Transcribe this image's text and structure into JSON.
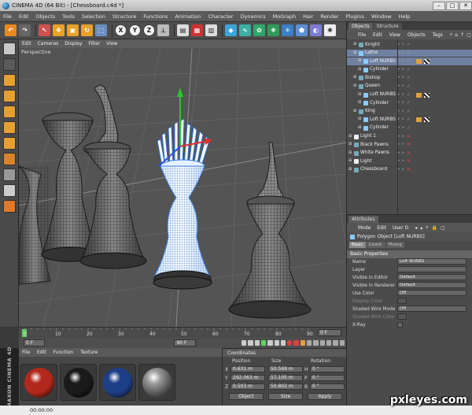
{
  "window": {
    "title": "CINEMA 4D (64 Bit) - [Chessboard.c4d *]"
  },
  "menu": [
    "File",
    "Edit",
    "Objects",
    "Tools",
    "Selection",
    "Structure",
    "Functions",
    "Animation",
    "Character",
    "Dynamics",
    "MoGraph",
    "Hair",
    "Render",
    "Plugins",
    "Window",
    "Help"
  ],
  "toolbar": {
    "axis_x": "X",
    "axis_y": "Y",
    "axis_z": "Z"
  },
  "viewport": {
    "menu": [
      "Edit",
      "Cameras",
      "Display",
      "Filter",
      "View"
    ],
    "label": "Perspective"
  },
  "timeline": {
    "ticks": [
      "0",
      "10",
      "20",
      "30",
      "40",
      "50",
      "60",
      "70",
      "80",
      "90"
    ],
    "end_label": "0 F",
    "start_frame": "0 F",
    "end_frame": "90 F"
  },
  "materials": {
    "menu": [
      "File",
      "Edit",
      "Function",
      "Texture"
    ],
    "swatches": [
      {
        "color": "#b3281d"
      },
      {
        "color": "#1a1a1a"
      },
      {
        "color": "#1e3f88"
      },
      {
        "color": "#8d8d8d"
      }
    ]
  },
  "maxon_logo": "MAXON CINEMA 4D",
  "coordinates": {
    "header": "Coordinates",
    "cols": [
      "Position",
      "Size",
      "Rotation"
    ],
    "rows": [
      {
        "axis": "X",
        "pos": "0.631 m",
        "size": "50.569 m",
        "rot_label": "H",
        "rot": "0 °"
      },
      {
        "axis": "Y",
        "pos": "292.063 m",
        "size": "57.105 m",
        "rot_label": "P",
        "rot": "0 °"
      },
      {
        "axis": "Z",
        "pos": "0.503 m",
        "size": "50.802 m",
        "rot_label": "B",
        "rot": "0 °"
      }
    ],
    "mode_object": "Object",
    "mode_size": "Size",
    "apply": "Apply"
  },
  "objects_panel": {
    "tabs": [
      "Objects",
      "Structure"
    ],
    "menu": [
      "File",
      "Edit",
      "View",
      "Objects",
      "Tags"
    ],
    "items": [
      {
        "label": "Knight",
        "indent": 1,
        "icon": "#7ab",
        "selected": false,
        "tag": false
      },
      {
        "label": "Lathe",
        "indent": 1,
        "icon": "#8cf",
        "selected": true,
        "tag": false
      },
      {
        "label": "Loft NURBS",
        "indent": 2,
        "icon": "#8cf",
        "selected": true,
        "tag": true
      },
      {
        "label": "Cylinder",
        "indent": 2,
        "icon": "#8cf",
        "selected": false,
        "tag": false
      },
      {
        "label": "Bishop",
        "indent": 1,
        "icon": "#7ab",
        "selected": false,
        "tag": false
      },
      {
        "label": "Queen",
        "indent": 1,
        "icon": "#7ab",
        "selected": false,
        "tag": false
      },
      {
        "label": "Loft NURBS",
        "indent": 2,
        "icon": "#8cf",
        "selected": false,
        "tag": true
      },
      {
        "label": "Cylinder",
        "indent": 2,
        "icon": "#8cf",
        "selected": false,
        "tag": false
      },
      {
        "label": "King",
        "indent": 1,
        "icon": "#7ab",
        "selected": false,
        "tag": false
      },
      {
        "label": "Loft NURBS",
        "indent": 2,
        "icon": "#8cf",
        "selected": false,
        "tag": true
      },
      {
        "label": "Cylinder",
        "indent": 2,
        "icon": "#8cf",
        "selected": false,
        "tag": false
      },
      {
        "label": "Light 1",
        "indent": 0,
        "icon": "#eee",
        "selected": false,
        "tag": false
      },
      {
        "label": "Black Pawns",
        "indent": 0,
        "icon": "#7ab",
        "selected": false,
        "tag": false
      },
      {
        "label": "White Pawns",
        "indent": 0,
        "icon": "#7ab",
        "selected": false,
        "tag": false
      },
      {
        "label": "Light",
        "indent": 0,
        "icon": "#eee",
        "selected": false,
        "tag": false
      },
      {
        "label": "Chessboard",
        "indent": 0,
        "icon": "#7ab",
        "selected": false,
        "tag": false
      }
    ],
    "dots": "• •"
  },
  "attributes": {
    "tab": "Attributes",
    "menu": [
      "Mode",
      "Edit",
      "User D"
    ],
    "title": "Polygon Object [Loft NURBS]",
    "subtabs": [
      "Basic",
      "Coord.",
      "Phong"
    ],
    "section": "Basic Properties",
    "props": [
      {
        "label": "Name",
        "value": "Loft NURBS",
        "dim": false,
        "type": "text"
      },
      {
        "label": "Layer",
        "value": "",
        "dim": false,
        "type": "text"
      },
      {
        "label": "Visible in Editor",
        "value": "Default",
        "dim": false,
        "type": "text"
      },
      {
        "label": "Visible in Renderer",
        "value": "Default",
        "dim": false,
        "type": "text"
      },
      {
        "label": "Use Color",
        "value": "Off",
        "dim": false,
        "type": "text"
      },
      {
        "label": "Display Color",
        "value": "",
        "dim": true,
        "type": "text"
      },
      {
        "label": "Shaded Wire Mode",
        "value": "Off",
        "dim": false,
        "type": "text"
      },
      {
        "label": "Shaded Wire Color",
        "value": "",
        "dim": true,
        "type": "text"
      },
      {
        "label": "X-Ray",
        "value": "",
        "dim": false,
        "type": "check"
      }
    ]
  },
  "status": {
    "time": "00:00:00"
  },
  "watermark": "pxleyes.com"
}
